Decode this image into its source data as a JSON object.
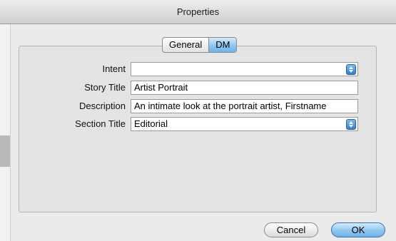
{
  "window": {
    "title": "Properties"
  },
  "tabs": [
    {
      "label": "General",
      "selected": false
    },
    {
      "label": "DM",
      "selected": true
    }
  ],
  "form": {
    "intent": {
      "label": "Intent",
      "value": ""
    },
    "story_title": {
      "label": "Story Title",
      "value": "Artist Portrait"
    },
    "description": {
      "label": "Description",
      "value": "An intimate look at the portrait artist, Firstname"
    },
    "section_title": {
      "label": "Section Title",
      "value": "Editorial"
    }
  },
  "buttons": {
    "cancel": "Cancel",
    "ok": "OK"
  },
  "colors": {
    "accent": "#6fb3e8",
    "stepper": "#2f7fd6",
    "panel": "#e4e4e4"
  }
}
